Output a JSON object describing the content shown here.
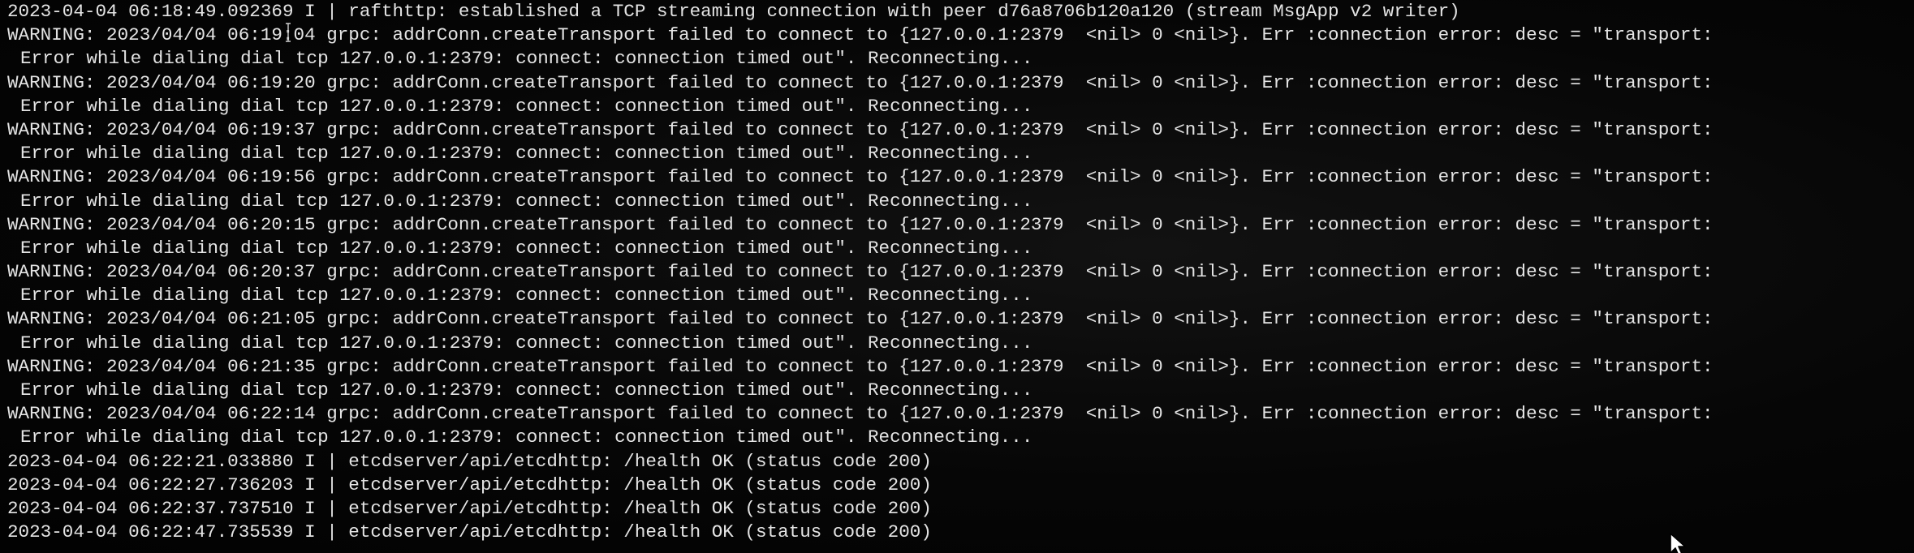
{
  "terminal": {
    "lines": [
      {
        "text": "2023-04-04 06:18:49.092369 I | rafthttp: established a TCP streaming connection with peer d76a8706b120a120 (stream MsgApp v2 writer)",
        "indent": false
      },
      {
        "text": "WARNING: 2023/04/04 06:19:04 grpc: addrConn.createTransport failed to connect to {127.0.0.1:2379  <nil> 0 <nil>}. Err :connection error: desc = \"transport:",
        "indent": false
      },
      {
        "text": "Error while dialing dial tcp 127.0.0.1:2379: connect: connection timed out\". Reconnecting...",
        "indent": true
      },
      {
        "text": "WARNING: 2023/04/04 06:19:20 grpc: addrConn.createTransport failed to connect to {127.0.0.1:2379  <nil> 0 <nil>}. Err :connection error: desc = \"transport:",
        "indent": false
      },
      {
        "text": "Error while dialing dial tcp 127.0.0.1:2379: connect: connection timed out\". Reconnecting...",
        "indent": true
      },
      {
        "text": "WARNING: 2023/04/04 06:19:37 grpc: addrConn.createTransport failed to connect to {127.0.0.1:2379  <nil> 0 <nil>}. Err :connection error: desc = \"transport:",
        "indent": false
      },
      {
        "text": "Error while dialing dial tcp 127.0.0.1:2379: connect: connection timed out\". Reconnecting...",
        "indent": true
      },
      {
        "text": "WARNING: 2023/04/04 06:19:56 grpc: addrConn.createTransport failed to connect to {127.0.0.1:2379  <nil> 0 <nil>}. Err :connection error: desc = \"transport:",
        "indent": false
      },
      {
        "text": "Error while dialing dial tcp 127.0.0.1:2379: connect: connection timed out\". Reconnecting...",
        "indent": true
      },
      {
        "text": "WARNING: 2023/04/04 06:20:15 grpc: addrConn.createTransport failed to connect to {127.0.0.1:2379  <nil> 0 <nil>}. Err :connection error: desc = \"transport:",
        "indent": false
      },
      {
        "text": "Error while dialing dial tcp 127.0.0.1:2379: connect: connection timed out\". Reconnecting...",
        "indent": true
      },
      {
        "text": "WARNING: 2023/04/04 06:20:37 grpc: addrConn.createTransport failed to connect to {127.0.0.1:2379  <nil> 0 <nil>}. Err :connection error: desc = \"transport:",
        "indent": false
      },
      {
        "text": "Error while dialing dial tcp 127.0.0.1:2379: connect: connection timed out\". Reconnecting...",
        "indent": true
      },
      {
        "text": "WARNING: 2023/04/04 06:21:05 grpc: addrConn.createTransport failed to connect to {127.0.0.1:2379  <nil> 0 <nil>}. Err :connection error: desc = \"transport:",
        "indent": false
      },
      {
        "text": "Error while dialing dial tcp 127.0.0.1:2379: connect: connection timed out\". Reconnecting...",
        "indent": true
      },
      {
        "text": "WARNING: 2023/04/04 06:21:35 grpc: addrConn.createTransport failed to connect to {127.0.0.1:2379  <nil> 0 <nil>}. Err :connection error: desc = \"transport:",
        "indent": false
      },
      {
        "text": "Error while dialing dial tcp 127.0.0.1:2379: connect: connection timed out\". Reconnecting...",
        "indent": true
      },
      {
        "text": "WARNING: 2023/04/04 06:22:14 grpc: addrConn.createTransport failed to connect to {127.0.0.1:2379  <nil> 0 <nil>}. Err :connection error: desc = \"transport:",
        "indent": false
      },
      {
        "text": "Error while dialing dial tcp 127.0.0.1:2379: connect: connection timed out\". Reconnecting...",
        "indent": true
      },
      {
        "text": "2023-04-04 06:22:21.033880 I | etcdserver/api/etcdhttp: /health OK (status code 200)",
        "indent": false
      },
      {
        "text": "2023-04-04 06:22:27.736203 I | etcdserver/api/etcdhttp: /health OK (status code 200)",
        "indent": false
      },
      {
        "text": "2023-04-04 06:22:37.737510 I | etcdserver/api/etcdhttp: /health OK (status code 200)",
        "indent": false
      },
      {
        "text": "2023-04-04 06:22:47.735539 I | etcdserver/api/etcdhttp: /health OK (status code 200)",
        "indent": false
      }
    ],
    "colors": {
      "background": "#050505",
      "text": "#e4e4e4"
    },
    "icons": {
      "mouse_pointer": "mouse-pointer-icon",
      "text_cursor": "text-cursor-icon"
    }
  }
}
